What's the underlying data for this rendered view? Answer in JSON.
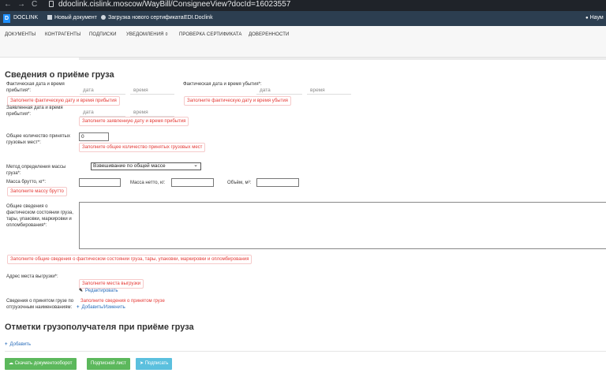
{
  "browser": {
    "back": "←",
    "forward": "→",
    "reload": "C",
    "url": "ddoclink.cislink.moscow/WayBill/ConsigneeView?docId=16023557"
  },
  "appbar": {
    "logo": "D",
    "brand": "DOCLINK",
    "new_doc": "Новый документ",
    "cert_upload": "Загрузка нового сертификата",
    "edi": "EDI.Doclink",
    "user": "Наум"
  },
  "menu": {
    "items": [
      "ДОКУМЕНТЫ",
      "КОНТРАГЕНТЫ",
      "ПОДПИСКИ",
      "УВЕДОМЛЕНИЯ",
      "ПРОВЕРКА СЕРТИФИКАТА",
      "ДОВЕРЕННОСТИ"
    ],
    "notif_count": "0"
  },
  "section1": {
    "title": "Сведения о приёме груза",
    "actual_arrival_label": "Фактическая дата и время прибытия*:",
    "actual_departure_label": "Фактическая дата и время убытия*:",
    "declared_arrival_label": "Заявленная дата и время прибытия*:",
    "date_ph": "дата",
    "time_ph": "время",
    "err_actual_arrival": "Заполните фактическую дату и время прибытия",
    "err_actual_departure": "Заполните фактическую дату и время убытия",
    "err_declared_arrival": "Заполните заявленную дату и время прибытия",
    "total_places_label": "Общее количество принятых грузовых мест*:",
    "total_places_value": "0",
    "err_total_places": "Заполните общее количество принятых грузовых мест",
    "mass_method_label": "Метод определения массы груза*:",
    "mass_method_value": "Взвешивание по общей массе",
    "gross_label": "Масса брутто, кг*:",
    "net_label": "Масса нетто, кг:",
    "volume_label": "Объём, м³:",
    "err_gross": "Заполните массу брутто",
    "condition_label": "Общие сведения о фактическом состоянии груза, тары, упаковки, маркировки и опломбирования*:",
    "err_condition": "Заполните общие сведения о фактическом состоянии груза, тары, упаковки, маркировки и опломбирования",
    "unload_label": "Адрес места выгрузки*:",
    "err_unload": "Заполните места выгрузки",
    "edit_link": "Редактировать",
    "cargo_info_label": "Сведения о принятом грузе по отгрузочным наименованиям:",
    "err_cargo_info": "Заполните сведения о принятом грузе",
    "add_change_link": "Добавить/Изменить"
  },
  "section2": {
    "title": "Отметки грузополучателя при приёме груза",
    "add_link": "Добавить"
  },
  "buttons": {
    "download": "Скачать документооборот",
    "sign_sheet": "Подписной лист",
    "sign": "Подписать"
  }
}
